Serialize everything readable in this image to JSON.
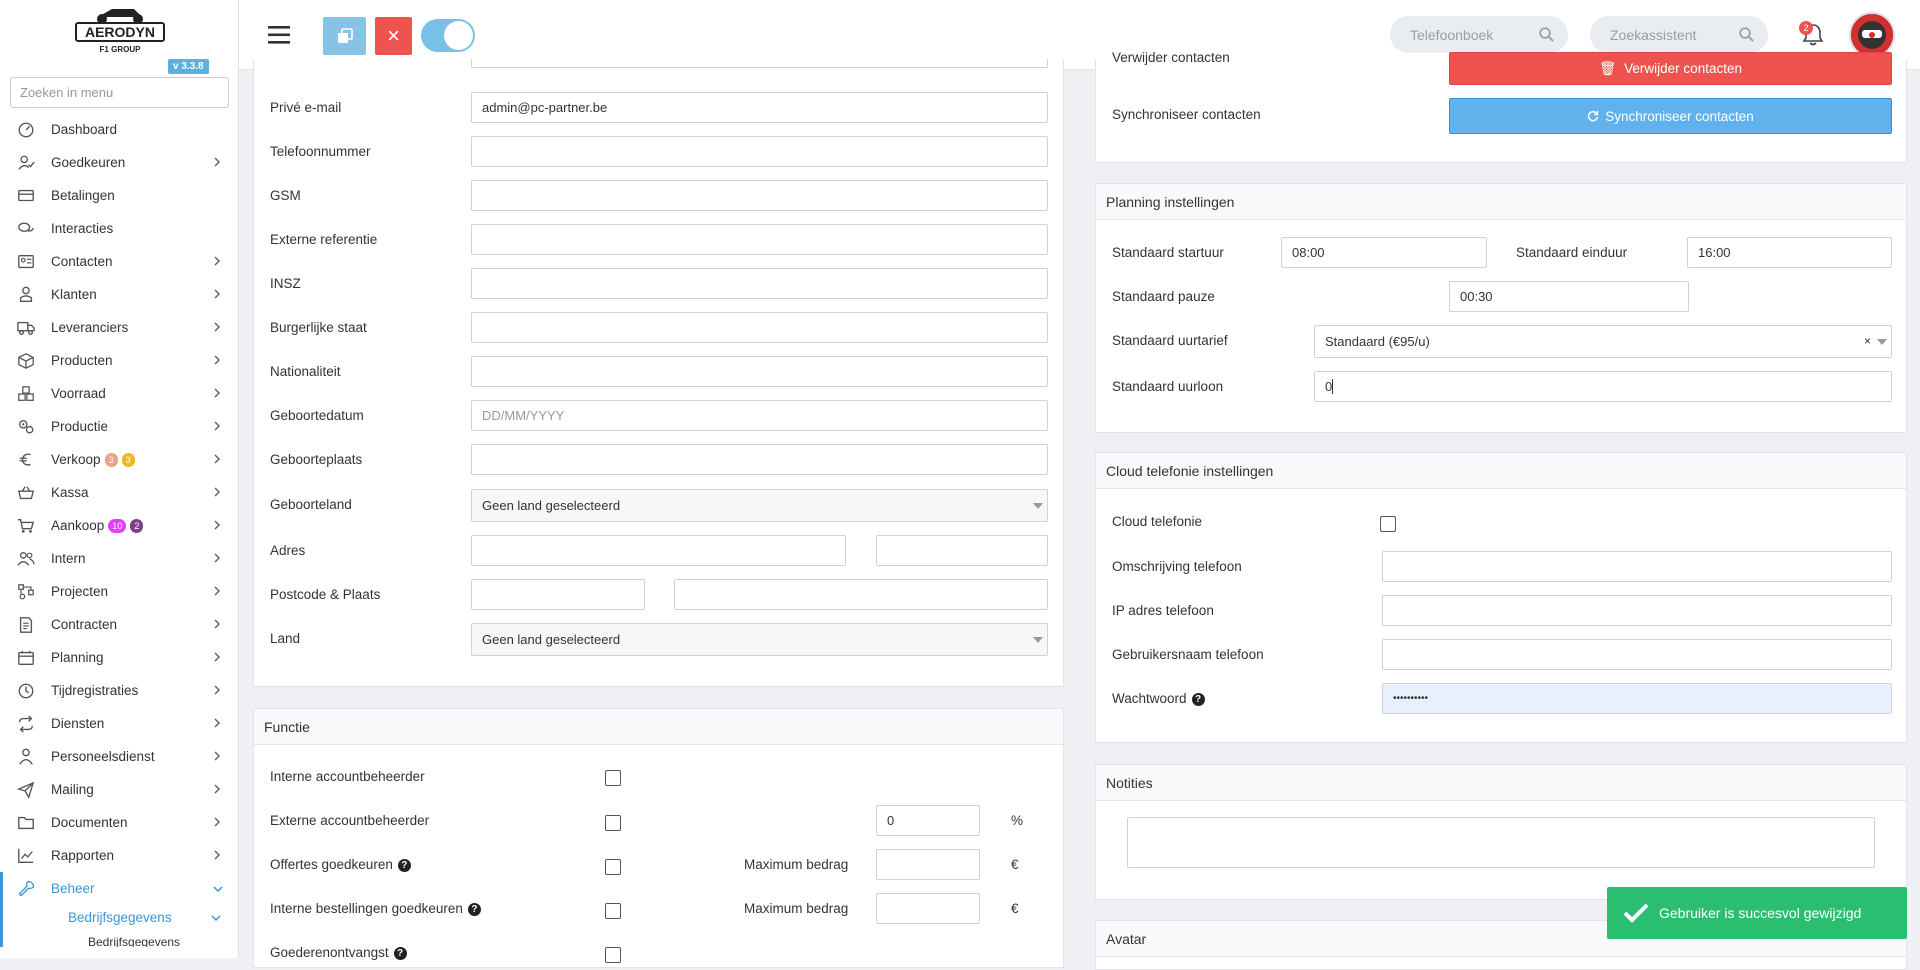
{
  "app": {
    "version": "v 3.3.8",
    "logo_text": "AERODYN",
    "logo_sub": "F1 GROUP"
  },
  "sidebar": {
    "search_placeholder": "Zoeken in menu",
    "items": [
      {
        "label": "Dashboard",
        "icon": "dashboard-icon",
        "chevron": false
      },
      {
        "label": "Goedkeuren",
        "icon": "user-check-icon",
        "chevron": true
      },
      {
        "label": "Betalingen",
        "icon": "credit-card-icon",
        "chevron": false
      },
      {
        "label": "Interacties",
        "icon": "chat-icon",
        "chevron": false
      },
      {
        "label": "Contacten",
        "icon": "contact-card-icon",
        "chevron": true
      },
      {
        "label": "Klanten",
        "icon": "customer-icon",
        "chevron": true
      },
      {
        "label": "Leveranciers",
        "icon": "truck-icon",
        "chevron": true
      },
      {
        "label": "Producten",
        "icon": "box-icon",
        "chevron": true
      },
      {
        "label": "Voorraad",
        "icon": "boxes-icon",
        "chevron": true
      },
      {
        "label": "Productie",
        "icon": "gears-icon",
        "chevron": true
      },
      {
        "label": "Verkoop",
        "icon": "euro-icon",
        "chevron": true,
        "badges": [
          {
            "text": "3",
            "color": "#e8a38a"
          },
          {
            "text": "3",
            "color": "#f0b429"
          }
        ]
      },
      {
        "label": "Kassa",
        "icon": "basket-icon",
        "chevron": true
      },
      {
        "label": "Aankoop",
        "icon": "cart-icon",
        "chevron": true,
        "badges": [
          {
            "text": "10",
            "color": "#e040fb"
          },
          {
            "text": "2",
            "color": "#7b3f8c"
          }
        ]
      },
      {
        "label": "Intern",
        "icon": "users-icon",
        "chevron": true
      },
      {
        "label": "Projecten",
        "icon": "project-icon",
        "chevron": true
      },
      {
        "label": "Contracten",
        "icon": "contract-icon",
        "chevron": true
      },
      {
        "label": "Planning",
        "icon": "calendar-icon",
        "chevron": true
      },
      {
        "label": "Tijdregistraties",
        "icon": "clock-icon",
        "chevron": true
      },
      {
        "label": "Diensten",
        "icon": "repeat-icon",
        "chevron": true
      },
      {
        "label": "Personeelsdienst",
        "icon": "staff-icon",
        "chevron": true
      },
      {
        "label": "Mailing",
        "icon": "paper-plane-icon",
        "chevron": true
      },
      {
        "label": "Documenten",
        "icon": "folder-icon",
        "chevron": true
      },
      {
        "label": "Rapporten",
        "icon": "chart-line-icon",
        "chevron": true
      },
      {
        "label": "Beheer",
        "icon": "wrench-icon",
        "chevron": true,
        "active": true
      }
    ],
    "sub_item": "Bedrijfsgegevens",
    "sub_sub_item": "Bedrijfsgegevens"
  },
  "header": {
    "search1_placeholder": "Telefoonboek",
    "search2_placeholder": "Zoekassistent",
    "notif_count": "2"
  },
  "personal": {
    "fields": [
      {
        "label": "Privé e-mail",
        "value": "admin@pc-partner.be"
      },
      {
        "label": "Telefoonnummer",
        "value": ""
      },
      {
        "label": "GSM",
        "value": ""
      },
      {
        "label": "Externe referentie",
        "value": ""
      },
      {
        "label": "INSZ",
        "value": ""
      },
      {
        "label": "Burgerlijke staat",
        "value": ""
      },
      {
        "label": "Nationaliteit",
        "value": ""
      },
      {
        "label": "Geboortedatum",
        "value": "",
        "placeholder": "DD/MM/YYYY"
      },
      {
        "label": "Geboorteplaats",
        "value": ""
      }
    ],
    "geboorteland_label": "Geboorteland",
    "geboorteland_value": "Geen land geselecteerd",
    "adres_label": "Adres",
    "postcode_label": "Postcode & Plaats",
    "land_label": "Land",
    "land_value": "Geen land geselecteerd"
  },
  "functie": {
    "title": "Functie",
    "interne_label": "Interne accountbeheerder",
    "externe_label": "Externe accountbeheerder",
    "externe_pct_value": "0",
    "pct_symbol": "%",
    "offertes_label": "Offertes goedkeuren",
    "bestellingen_label": "Interne bestellingen goedkeuren",
    "goederen_label": "Goederenontvangst",
    "max_label": "Maximum bedrag",
    "euro_symbol": "€"
  },
  "contacts": {
    "delete_label": "Verwijder contacten",
    "delete_button": "Verwijder contacten",
    "sync_label": "Synchroniseer contacten",
    "sync_button": "Synchroniseer contacten"
  },
  "planning": {
    "title": "Planning instellingen",
    "start_label": "Standaard startuur",
    "start_value": "08:00",
    "end_label": "Standaard einduur",
    "end_value": "16:00",
    "pause_label": "Standaard pauze",
    "pause_value": "00:30",
    "rate_label": "Standaard uurtarief",
    "rate_value": "Standaard (€95/u)",
    "wage_label": "Standaard uurloon",
    "wage_value": "0"
  },
  "cloud": {
    "title": "Cloud telefonie instellingen",
    "enable_label": "Cloud telefonie",
    "desc_label": "Omschrijving telefoon",
    "ip_label": "IP adres telefoon",
    "user_label": "Gebruikersnaam telefoon",
    "pw_label": "Wachtwoord",
    "pw_value": "••••••••••"
  },
  "notes": {
    "title": "Notities"
  },
  "avatar_panel": {
    "title": "Avatar"
  },
  "toast": {
    "message": "Gebruiker is succesvol gewijzigd"
  }
}
